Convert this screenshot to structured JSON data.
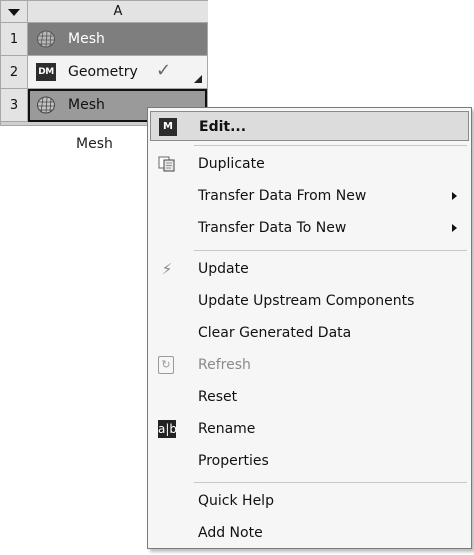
{
  "system": {
    "column_header": "A",
    "rows": [
      {
        "num": "1",
        "label": "Mesh",
        "icon": "mesh-icon"
      },
      {
        "num": "2",
        "label": "Geometry",
        "icon": "dm-icon",
        "icon_text": "DM",
        "status": "✓"
      },
      {
        "num": "3",
        "label": "Mesh",
        "icon": "mesh-icon"
      }
    ],
    "title": "Mesh"
  },
  "menu": {
    "edit": "Edit...",
    "edit_icon_text": "M",
    "duplicate": "Duplicate",
    "transfer_from": "Transfer Data From New",
    "transfer_to": "Transfer Data To New",
    "update": "Update",
    "update_upstream": "Update Upstream Components",
    "clear_generated": "Clear Generated Data",
    "refresh": "Refresh",
    "reset": "Reset",
    "rename": "Rename",
    "rename_icon_text": "a|b",
    "properties": "Properties",
    "quick_help": "Quick Help",
    "add_note": "Add Note"
  },
  "colors": {
    "highlight": "#dcdcdc",
    "row1_bg": "#7e7e7e",
    "row3_bg": "#9a9a9a",
    "disabled_text": "#8a8a8a"
  }
}
